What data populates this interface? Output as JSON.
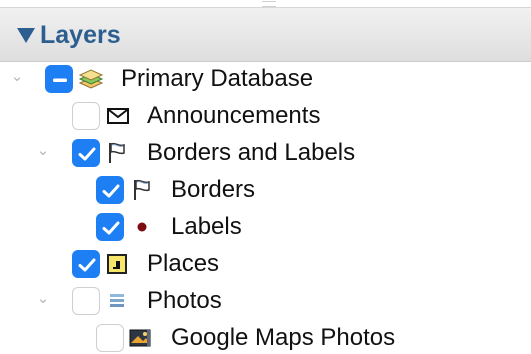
{
  "panel": {
    "title": "Layers"
  },
  "tree": {
    "primary_database": {
      "label": "Primary Database",
      "state": "mixed",
      "expanded": true,
      "icon": "stacked-layers-icon"
    },
    "announcements": {
      "label": "Announcements",
      "state": "unchecked",
      "icon": "envelope-icon"
    },
    "borders_and_labels": {
      "label": "Borders and Labels",
      "state": "checked",
      "expanded": true,
      "icon": "flag-icon"
    },
    "borders": {
      "label": "Borders",
      "state": "checked",
      "icon": "flag-icon"
    },
    "labels": {
      "label": "Labels",
      "state": "checked",
      "icon": "dot-icon"
    },
    "places": {
      "label": "Places",
      "state": "checked",
      "icon": "places-icon"
    },
    "photos": {
      "label": "Photos",
      "state": "unchecked",
      "expanded": true,
      "icon": "photos-list-icon"
    },
    "google_maps_photos": {
      "label": "Google Maps Photos",
      "state": "unchecked",
      "icon": "photo-icon"
    }
  },
  "colors": {
    "checkbox_blue": "#1e7ff5",
    "header_text": "#2c5f8f",
    "label_text": "#111111",
    "dark_red_dot": "#7b0d12"
  }
}
